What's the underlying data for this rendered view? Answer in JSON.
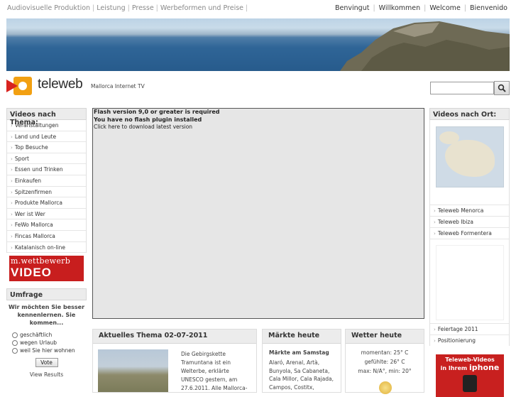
{
  "top_nav_left": [
    "Audiovisuelle Produktion",
    "Leistung",
    "Presse",
    "Werbeformen und Preise"
  ],
  "top_nav_right": [
    "Benvingut",
    "Willkommen",
    "Welcome",
    "Bienvenido"
  ],
  "logo": {
    "name": "teleweb",
    "tagline": "Mallorca Internet TV"
  },
  "search": {
    "placeholder": ""
  },
  "left_sidebar": {
    "title": "Videos nach Thema:",
    "items": [
      "Veranstaltungen",
      "Land und Leute",
      "Top Besuche",
      "Sport",
      "Essen und Trinken",
      "Einkaufen",
      "Spitzenfirmen",
      "Produkte Mallorca",
      "Wer ist Wer",
      "FeWo Mallorca",
      "Fincas Mallorca",
      "Katalanisch on-line"
    ],
    "ad": {
      "line1": "m.wettbewerb",
      "line2": "VIDEO"
    }
  },
  "poll": {
    "title": "Umfrage",
    "question": "Wir möchten Sie besser kennenlernen. Sie kommen...",
    "options": [
      "geschäftlich",
      "wegen Urlaub",
      "weil Sie hier wohnen"
    ],
    "vote_label": "Vote",
    "results_label": "View Results"
  },
  "flash": {
    "line1": "Flash version 9,0 or greater is required",
    "line2": "You have no flash plugin installed",
    "line3": "Click here to download latest version"
  },
  "aktuelles": {
    "title": "Aktuelles Thema 02-07-2011",
    "text": "Die Gebirgskette Tramuntana ist ein Welterbe, erklärte UNESCO gestern, am 27.6.2011. Alle Mallorca-"
  },
  "maerkte": {
    "title": "Märkte heute",
    "subtitle": "Märkte am Samstag",
    "text": "Alaró, Arenal, Artà, Bunyola, Sa Cabaneta, Cala Millor, Cala Rajada, Campos, Costitx,"
  },
  "wetter": {
    "title": "Wetter heute",
    "now": "momentan: 25° C",
    "felt": "gefühlte: 26° C",
    "range": "max: N/A°, min: 20°"
  },
  "right_sidebar": {
    "title": "Videos nach Ort:",
    "places": [
      "Teleweb Menorca",
      "Teleweb Ibiza",
      "Teleweb Formentera"
    ],
    "extra": [
      "Feiertage 2011",
      "Positionierung"
    ],
    "iphone_ad": {
      "line1": "Teleweb-Videos",
      "line2_prefix": "in Ihrem",
      "line2_brand": "iphone"
    }
  },
  "colors": {
    "brand_red": "#c8201f",
    "panel_head_bg": "#ececec",
    "flash_bg": "#e6e6e6"
  }
}
